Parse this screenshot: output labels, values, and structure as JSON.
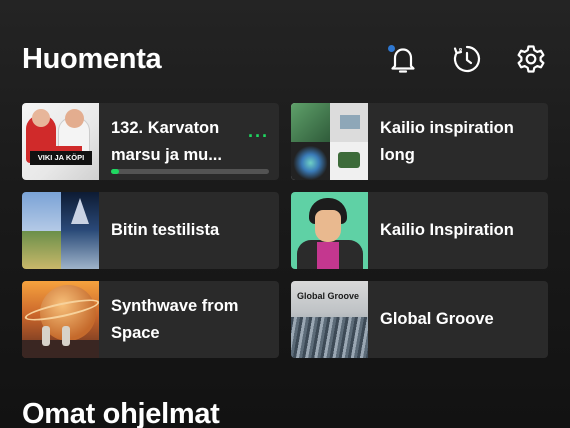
{
  "header": {
    "greeting": "Huomenta",
    "actions": [
      {
        "icon": "bell-icon",
        "label": "Notifications",
        "has_badge": true
      },
      {
        "icon": "history-icon",
        "label": "Recently played"
      },
      {
        "icon": "gear-icon",
        "label": "Settings"
      }
    ]
  },
  "shortcuts": [
    {
      "title_line1": "132. Karvaton",
      "title_line2": "marsu ja mu...",
      "thumb_text": "VIKI JA KÖPI",
      "progress": 0.05,
      "more_glyph": "···"
    },
    {
      "title_line1": "Kailio inspiration",
      "title_line2": "long"
    },
    {
      "title_line1": "Bitin testilista",
      "title_line2": ""
    },
    {
      "title_line1": "Kailio Inspiration",
      "title_line2": ""
    },
    {
      "title_line1": "Synthwave from",
      "title_line2": "Space"
    },
    {
      "title_line1": "Global Groove",
      "title_line2": "",
      "thumb_text": "Global Groove"
    }
  ],
  "sections": {
    "own_shows": "Omat ohjelmat"
  },
  "colors": {
    "background": "#121212",
    "card": "#2a2a2a",
    "accent": "#1ed760",
    "badge": "#2e77d0"
  }
}
